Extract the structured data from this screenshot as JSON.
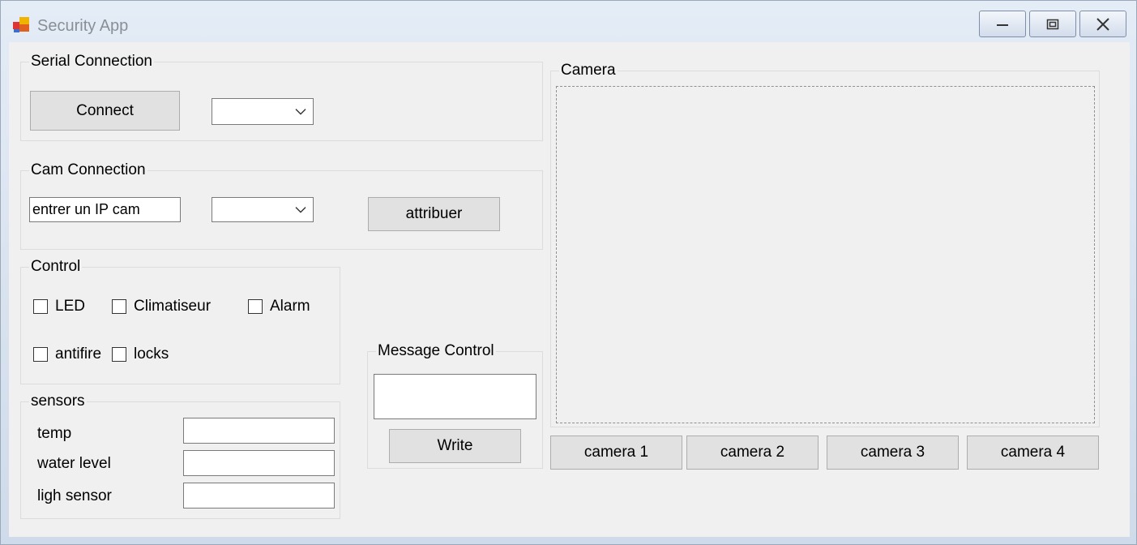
{
  "window": {
    "title": "Security App",
    "colors": {
      "title_text": "#8a8f96",
      "client_bg": "#f0f0f0",
      "button_bg": "#e1e1e1"
    }
  },
  "serial": {
    "group_label": "Serial Connection",
    "connect_label": "Connect",
    "port_value": ""
  },
  "cam_connection": {
    "group_label": "Cam Connection",
    "ip_value": "entrer un IP cam",
    "cam_select_value": "",
    "assign_label": "attribuer"
  },
  "control": {
    "group_label": "Control",
    "checkboxes": [
      "LED",
      "Climatiseur",
      "Alarm",
      "antifire",
      "locks"
    ]
  },
  "message": {
    "group_label": "Message Control",
    "message_value": "",
    "write_label": "Write"
  },
  "sensors": {
    "group_label": "sensors",
    "items": [
      {
        "label": "temp",
        "value": ""
      },
      {
        "label": "water level",
        "value": ""
      },
      {
        "label": "ligh sensor",
        "value": ""
      }
    ]
  },
  "camera": {
    "group_label": "Camera",
    "buttons": [
      "camera 1",
      "camera 2",
      "camera 3",
      "camera 4"
    ]
  },
  "icons": [
    "app-icon",
    "minimize-icon",
    "maximize-icon",
    "close-icon",
    "chevron-down-icon"
  ]
}
